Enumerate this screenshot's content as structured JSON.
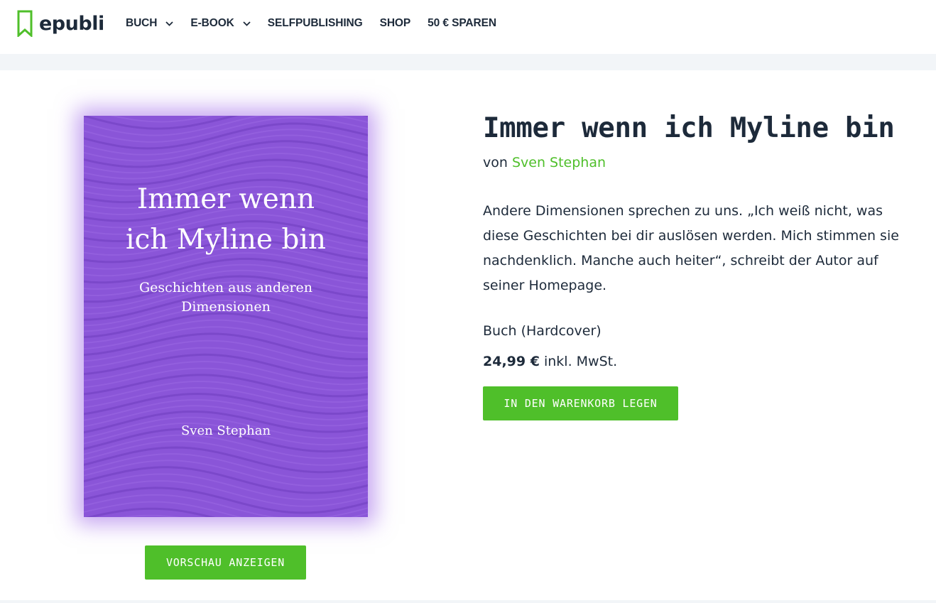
{
  "header": {
    "logo_text": "epubli",
    "logo_icon": "bookmark-icon",
    "nav": [
      {
        "label": "BUCH",
        "has_dropdown": true
      },
      {
        "label": "E-BOOK",
        "has_dropdown": true
      },
      {
        "label": "SELFPUBLISHING",
        "has_dropdown": false
      },
      {
        "label": "SHOP",
        "has_dropdown": false
      },
      {
        "label": "50 € SPAREN",
        "has_dropdown": false
      }
    ]
  },
  "cover": {
    "title_line1": "Immer wenn",
    "title_line2": "ich Myline bin",
    "subtitle_line1": "Geschichten aus anderen",
    "subtitle_line2": "Dimensionen",
    "author": "Sven Stephan",
    "background_color": "#8a55d8"
  },
  "preview_button": "VORSCHAU ANZEIGEN",
  "product": {
    "title": "Immer wenn ich Myline bin",
    "by_prefix": "von",
    "author": "Sven Stephan",
    "description": "Andere Dimensionen sprechen zu uns. „Ich weiß nicht, was diese Geschichten bei dir auslösen werden. Mich stimmen sie nachdenklich. Manche auch heiter“, schreibt der Autor auf seiner Homepage.",
    "format": "Buch (Hardcover)",
    "price": "24,99 €",
    "price_suffix": "inkl. MwSt.",
    "cart_button": "IN DEN WARENKORB LEGEN"
  },
  "colors": {
    "accent": "#4fbf2a",
    "text": "#1d2a3a",
    "strip": "#f2f5f8"
  }
}
